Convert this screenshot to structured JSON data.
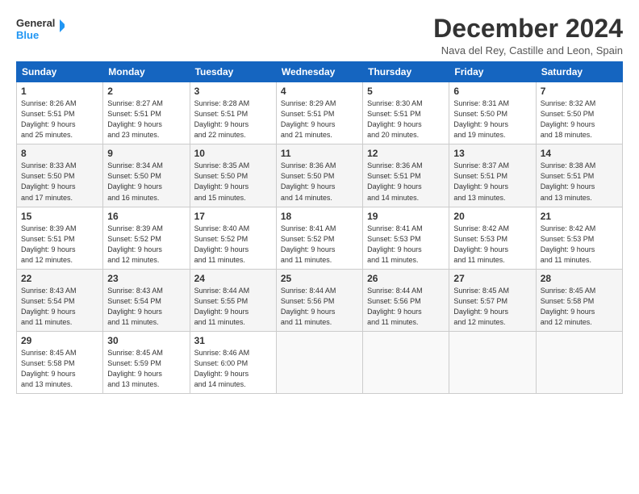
{
  "header": {
    "logo_general": "General",
    "logo_blue": "Blue",
    "title": "December 2024",
    "location": "Nava del Rey, Castille and Leon, Spain"
  },
  "weekdays": [
    "Sunday",
    "Monday",
    "Tuesday",
    "Wednesday",
    "Thursday",
    "Friday",
    "Saturday"
  ],
  "weeks": [
    [
      {
        "day": "1",
        "info": "Sunrise: 8:26 AM\nSunset: 5:51 PM\nDaylight: 9 hours\nand 25 minutes."
      },
      {
        "day": "2",
        "info": "Sunrise: 8:27 AM\nSunset: 5:51 PM\nDaylight: 9 hours\nand 23 minutes."
      },
      {
        "day": "3",
        "info": "Sunrise: 8:28 AM\nSunset: 5:51 PM\nDaylight: 9 hours\nand 22 minutes."
      },
      {
        "day": "4",
        "info": "Sunrise: 8:29 AM\nSunset: 5:51 PM\nDaylight: 9 hours\nand 21 minutes."
      },
      {
        "day": "5",
        "info": "Sunrise: 8:30 AM\nSunset: 5:51 PM\nDaylight: 9 hours\nand 20 minutes."
      },
      {
        "day": "6",
        "info": "Sunrise: 8:31 AM\nSunset: 5:50 PM\nDaylight: 9 hours\nand 19 minutes."
      },
      {
        "day": "7",
        "info": "Sunrise: 8:32 AM\nSunset: 5:50 PM\nDaylight: 9 hours\nand 18 minutes."
      }
    ],
    [
      {
        "day": "8",
        "info": "Sunrise: 8:33 AM\nSunset: 5:50 PM\nDaylight: 9 hours\nand 17 minutes."
      },
      {
        "day": "9",
        "info": "Sunrise: 8:34 AM\nSunset: 5:50 PM\nDaylight: 9 hours\nand 16 minutes."
      },
      {
        "day": "10",
        "info": "Sunrise: 8:35 AM\nSunset: 5:50 PM\nDaylight: 9 hours\nand 15 minutes."
      },
      {
        "day": "11",
        "info": "Sunrise: 8:36 AM\nSunset: 5:50 PM\nDaylight: 9 hours\nand 14 minutes."
      },
      {
        "day": "12",
        "info": "Sunrise: 8:36 AM\nSunset: 5:51 PM\nDaylight: 9 hours\nand 14 minutes."
      },
      {
        "day": "13",
        "info": "Sunrise: 8:37 AM\nSunset: 5:51 PM\nDaylight: 9 hours\nand 13 minutes."
      },
      {
        "day": "14",
        "info": "Sunrise: 8:38 AM\nSunset: 5:51 PM\nDaylight: 9 hours\nand 13 minutes."
      }
    ],
    [
      {
        "day": "15",
        "info": "Sunrise: 8:39 AM\nSunset: 5:51 PM\nDaylight: 9 hours\nand 12 minutes."
      },
      {
        "day": "16",
        "info": "Sunrise: 8:39 AM\nSunset: 5:52 PM\nDaylight: 9 hours\nand 12 minutes."
      },
      {
        "day": "17",
        "info": "Sunrise: 8:40 AM\nSunset: 5:52 PM\nDaylight: 9 hours\nand 11 minutes."
      },
      {
        "day": "18",
        "info": "Sunrise: 8:41 AM\nSunset: 5:52 PM\nDaylight: 9 hours\nand 11 minutes."
      },
      {
        "day": "19",
        "info": "Sunrise: 8:41 AM\nSunset: 5:53 PM\nDaylight: 9 hours\nand 11 minutes."
      },
      {
        "day": "20",
        "info": "Sunrise: 8:42 AM\nSunset: 5:53 PM\nDaylight: 9 hours\nand 11 minutes."
      },
      {
        "day": "21",
        "info": "Sunrise: 8:42 AM\nSunset: 5:53 PM\nDaylight: 9 hours\nand 11 minutes."
      }
    ],
    [
      {
        "day": "22",
        "info": "Sunrise: 8:43 AM\nSunset: 5:54 PM\nDaylight: 9 hours\nand 11 minutes."
      },
      {
        "day": "23",
        "info": "Sunrise: 8:43 AM\nSunset: 5:54 PM\nDaylight: 9 hours\nand 11 minutes."
      },
      {
        "day": "24",
        "info": "Sunrise: 8:44 AM\nSunset: 5:55 PM\nDaylight: 9 hours\nand 11 minutes."
      },
      {
        "day": "25",
        "info": "Sunrise: 8:44 AM\nSunset: 5:56 PM\nDaylight: 9 hours\nand 11 minutes."
      },
      {
        "day": "26",
        "info": "Sunrise: 8:44 AM\nSunset: 5:56 PM\nDaylight: 9 hours\nand 11 minutes."
      },
      {
        "day": "27",
        "info": "Sunrise: 8:45 AM\nSunset: 5:57 PM\nDaylight: 9 hours\nand 12 minutes."
      },
      {
        "day": "28",
        "info": "Sunrise: 8:45 AM\nSunset: 5:58 PM\nDaylight: 9 hours\nand 12 minutes."
      }
    ],
    [
      {
        "day": "29",
        "info": "Sunrise: 8:45 AM\nSunset: 5:58 PM\nDaylight: 9 hours\nand 13 minutes."
      },
      {
        "day": "30",
        "info": "Sunrise: 8:45 AM\nSunset: 5:59 PM\nDaylight: 9 hours\nand 13 minutes."
      },
      {
        "day": "31",
        "info": "Sunrise: 8:46 AM\nSunset: 6:00 PM\nDaylight: 9 hours\nand 14 minutes."
      },
      null,
      null,
      null,
      null
    ]
  ]
}
